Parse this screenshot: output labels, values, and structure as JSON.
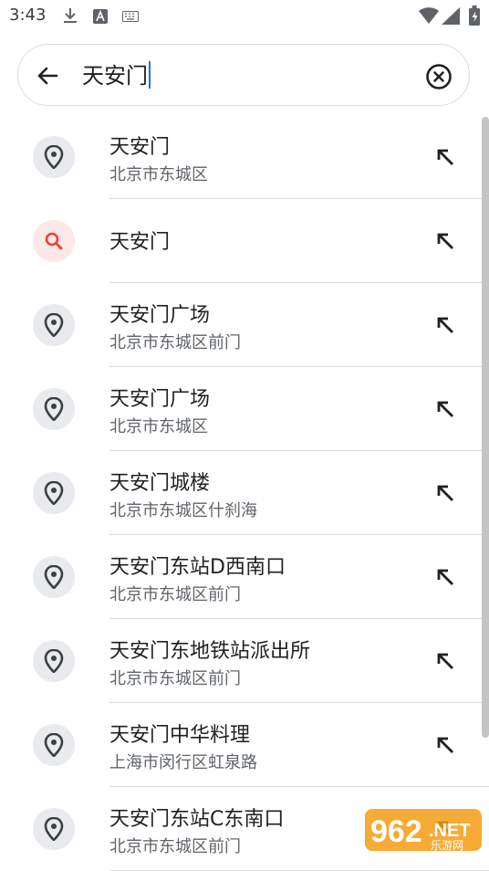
{
  "status_bar": {
    "time": "3:43",
    "icons": [
      "download-icon",
      "keyboard-badge-icon",
      "keyboard-icon",
      "wifi-icon",
      "signal-icon",
      "battery-icon"
    ]
  },
  "search": {
    "query": "天安门",
    "back_icon": "arrow-back-icon",
    "clear_icon": "clear-circle-icon"
  },
  "results": [
    {
      "type": "place",
      "title": "天安门",
      "subtitle": "北京市东城区"
    },
    {
      "type": "query",
      "title": "天安门",
      "subtitle": ""
    },
    {
      "type": "place",
      "title": "天安门广场",
      "subtitle": "北京市东城区前门"
    },
    {
      "type": "place",
      "title": "天安门广场",
      "subtitle": "北京市东城区"
    },
    {
      "type": "place",
      "title": "天安门城楼",
      "subtitle": "北京市东城区什刹海"
    },
    {
      "type": "place",
      "title": "天安门东站D西南口",
      "subtitle": "北京市东城区前门"
    },
    {
      "type": "place",
      "title": "天安门东地铁站派出所",
      "subtitle": "北京市东城区前门"
    },
    {
      "type": "place",
      "title": "天安门中华料理",
      "subtitle": "上海市闵行区虹泉路"
    },
    {
      "type": "place",
      "title": "天安门东站C东南口",
      "subtitle": "北京市东城区前门"
    }
  ],
  "watermark": {
    "number": "962",
    "suffix": ".NET",
    "caption": "乐游网"
  },
  "colors": {
    "accent": "#1a73e8",
    "search_icon": "#ea4335",
    "pin_bg": "#e8eaed",
    "search_bg": "#fce8e6"
  }
}
